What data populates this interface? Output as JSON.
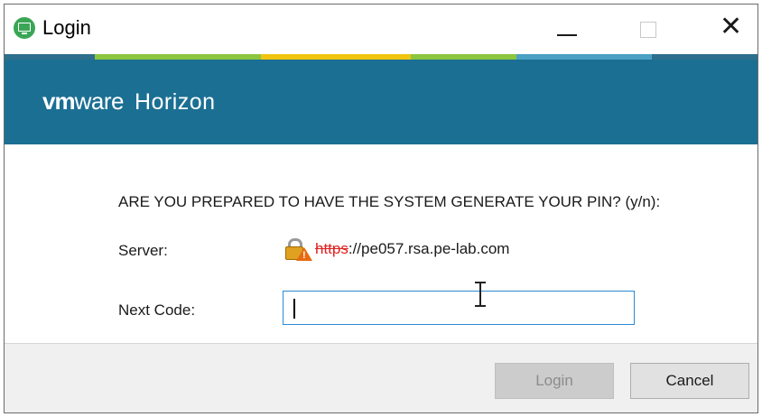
{
  "window": {
    "title": "Login",
    "app_icon": "horizon-client-icon",
    "controls": {
      "minimize_icon": "minimize-icon",
      "maximize_icon": "maximize-icon",
      "close_icon": "close-icon",
      "close_glyph": "✕"
    }
  },
  "banner": {
    "brand_vm": "vm",
    "brand_ware": "ware",
    "product": "Horizon",
    "background_color": "#1b6f93",
    "stripe_colors": [
      "#2d6f8c",
      "#8cc63f",
      "#f1c40f",
      "#8cc63f",
      "#4ba0c4",
      "#2d6f8c"
    ]
  },
  "form": {
    "prompt": "ARE YOU PREPARED TO HAVE THE SYSTEM GENERATE YOUR PIN? (y/n):",
    "server_label": "Server:",
    "server_scheme": "https",
    "server_rest": "://pe057.rsa.pe-lab.com",
    "server_icon": "certificate-warning-lock-icon",
    "next_code_label": "Next Code:",
    "next_code_value": ""
  },
  "buttons": {
    "login": "Login",
    "login_enabled": false,
    "cancel": "Cancel"
  }
}
